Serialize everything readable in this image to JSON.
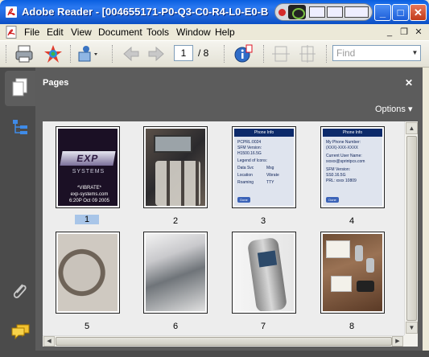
{
  "window": {
    "title": "Adobe Reader - [004655171-P0-Q3-C0-R4-L0-E0-B",
    "minimize_glyph": "_",
    "maximize_glyph": "□",
    "close_glyph": "✕"
  },
  "menu": {
    "items": [
      "File",
      "Edit",
      "View",
      "Document",
      "Tools",
      "Window",
      "Help"
    ],
    "mdi_minimize": "_",
    "mdi_restore": "❐",
    "mdi_close": "✕"
  },
  "toolbar": {
    "current_page": "1",
    "total_pages": "/ 8",
    "find_placeholder": "Find"
  },
  "pages_panel": {
    "title": "Pages",
    "close_glyph": "✕",
    "options_label": "Options ▾",
    "thumbnails": [
      {
        "label": "1",
        "selected": true
      },
      {
        "label": "2",
        "selected": false
      },
      {
        "label": "3",
        "selected": false
      },
      {
        "label": "4",
        "selected": false
      },
      {
        "label": "5",
        "selected": false
      },
      {
        "label": "6",
        "selected": false
      },
      {
        "label": "7",
        "selected": false
      },
      {
        "label": "8",
        "selected": false
      }
    ]
  },
  "thumb_text": {
    "p1_logo": "EXP",
    "p1_sub": "SYSTEMS",
    "p1_line1": "*VIBRATE*",
    "p1_line2": "exp-systems.com",
    "p1_line3": "6:20P Oct 09 2005",
    "p3_header": "Phone Info",
    "p3_lines": [
      "PCPRL:0024",
      "SFM Version:",
      "H1500.16.5G",
      "Legend of Icons:",
      "Data Svc",
      "Msg",
      "Location",
      "Vibrate",
      "Roaming",
      "TTY"
    ],
    "p4_header": "Phone Info",
    "p4_lines": [
      "My Phone Number:",
      "(XXX)-XXX-XXXX",
      "Current User Name:",
      "xxxxx@sprintpcs.com",
      "SFM Version:",
      "SS0.16.5G",
      "PRL: xxxx 10809"
    ],
    "done": "Done"
  },
  "colors": {
    "titlebar": "#1d63d8",
    "panel": "#5c5c5c",
    "rail": "#4b4b4b",
    "selection": "#a8c5e8"
  },
  "icons": [
    "adobe-reader-icon",
    "print-icon",
    "organizer-icon",
    "collaborate-icon",
    "back-arrow-icon",
    "forward-arrow-icon",
    "info-icon",
    "fit-width-icon",
    "fit-page-icon",
    "pages-icon",
    "bookmarks-icon",
    "attachments-icon",
    "comments-icon"
  ]
}
